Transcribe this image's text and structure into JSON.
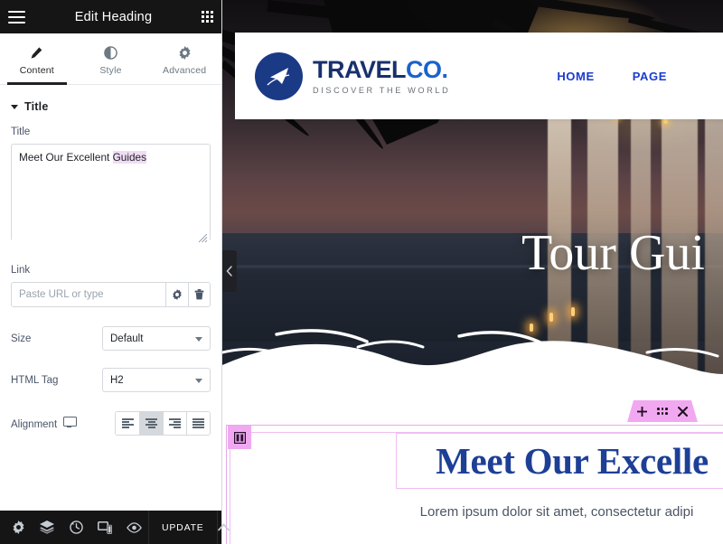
{
  "panel": {
    "header": {
      "title": "Edit Heading",
      "menu_icon": "hamburger-icon",
      "apps_icon": "apps-grid-icon"
    },
    "tabs": [
      {
        "label": "Content",
        "icon": "pencil-icon",
        "active": true
      },
      {
        "label": "Style",
        "icon": "contrast-icon",
        "active": false
      },
      {
        "label": "Advanced",
        "icon": "gear-icon",
        "active": false
      }
    ],
    "section": {
      "label": "Title",
      "expanded": true
    },
    "controls": {
      "title_label": "Title",
      "title_value": "Meet Our Excellent Guides",
      "title_value_plain": "Meet Our Excellent ",
      "title_value_highlight": "Guides",
      "link_label": "Link",
      "link_value": "",
      "link_placeholder": "Paste URL or type",
      "link_settings_icon": "gear-icon",
      "link_dynamic_icon": "dynamic-tag-icon",
      "size_label": "Size",
      "size_value": "Default",
      "html_tag_label": "HTML Tag",
      "html_tag_value": "H2",
      "alignment_label": "Alignment",
      "alignment_device_icon": "desktop-icon",
      "alignment_options": [
        "left",
        "center",
        "right",
        "justify"
      ],
      "alignment_selected": "center"
    },
    "footer": {
      "icons": [
        "settings-icon",
        "navigator-layers-icon",
        "history-icon",
        "responsive-mode-icon",
        "preview-eye-icon"
      ],
      "update_label": "UPDATE",
      "caret_icon": "chevron-up-icon"
    },
    "collapse_handle_icon": "chevron-left-icon"
  },
  "preview": {
    "site_header": {
      "logo": {
        "icon": "airplane-icon",
        "name_dark": "TRAVEL",
        "name_bright": "CO.",
        "tagline": "DISCOVER THE WORLD"
      },
      "nav": [
        {
          "label": "HOME"
        },
        {
          "label": "PAGE"
        }
      ]
    },
    "hero": {
      "title": "Tour Gui"
    },
    "section": {
      "heading": "Meet Our Excelle",
      "subtext": "Lorem ipsum dolor sit amet, consectetur adipi"
    },
    "widget_toolbar": {
      "add_icon": "plus-icon",
      "drag_icon": "drag-handle-icon",
      "delete_icon": "close-x-icon"
    },
    "column_badge_icon": "column-widget-icon"
  },
  "colors": {
    "panel_dark": "#151515",
    "accent_pink": "#f1a8f1",
    "brand_navy": "#18306e",
    "brand_blue": "#1a63c9",
    "nav_blue": "#1a3ccc",
    "heading_blue": "#1d3f96",
    "highlight": "#f0dcf5"
  }
}
